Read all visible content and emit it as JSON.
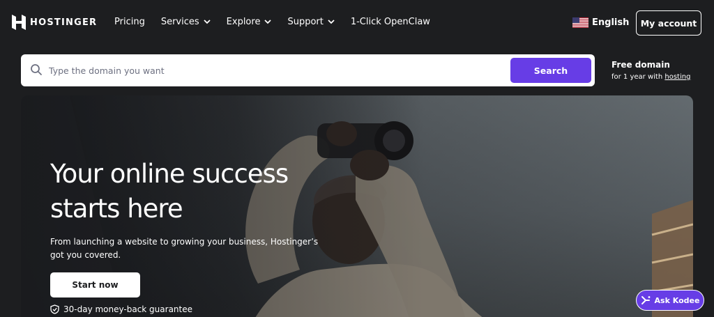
{
  "brand": {
    "name": "HOSTINGER",
    "logo_icon": "hostinger-h-icon"
  },
  "nav": {
    "links": [
      {
        "label": "Pricing",
        "dropdown": false
      },
      {
        "label": "Services",
        "dropdown": true
      },
      {
        "label": "Explore",
        "dropdown": true
      },
      {
        "label": "Support",
        "dropdown": true
      },
      {
        "label": "1-Click OpenClaw",
        "dropdown": false
      }
    ],
    "language": "English",
    "account_label": "My account"
  },
  "search": {
    "placeholder": "Type the domain you want",
    "button_label": "Search"
  },
  "free_domain": {
    "title": "Free domain",
    "sub_prefix": "for 1 year with ",
    "sub_link": "hosting"
  },
  "hero": {
    "title": "Your online success starts here",
    "subtitle": "From launching a website to growing your business, Hostinger’s got you covered.",
    "cta_label": "Start now",
    "guarantee": "30-day money-back guarantee"
  },
  "chat": {
    "label": "Ask Kodee"
  },
  "colors": {
    "accent": "#673de6",
    "background": "#1d1e20"
  }
}
